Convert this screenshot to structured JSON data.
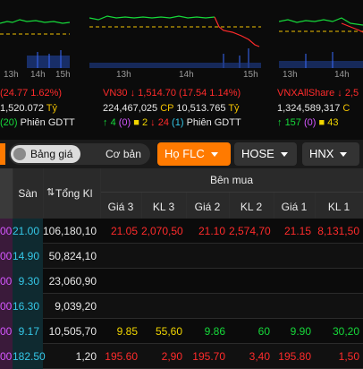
{
  "colors": {
    "up": "#16d93a",
    "down": "#ff2b2b",
    "ref": "#f2c200",
    "ceiling": "#d457ff",
    "floor": "#35c8e8",
    "accent": "#ff7a00"
  },
  "panels": [
    {
      "name": "vnindex",
      "ticks": [
        "13h",
        "14h",
        "15h"
      ]
    },
    {
      "name": "vn30",
      "ticks": [
        "13h",
        "14h",
        "15h"
      ]
    },
    {
      "name": "vnxallshare",
      "ticks": [
        "13h",
        "14h"
      ]
    }
  ],
  "indices": [
    {
      "name": "",
      "change": "(24.77 1.62%)",
      "volume": "1,520.072",
      "unit": "Tỷ",
      "sessions_count": "(20)",
      "sessions_label": "Phiên GDTT"
    },
    {
      "name": "VN30",
      "arrow": "↓",
      "value": "1,514.70",
      "change": "(17.54 1.14%)",
      "volume": "224,467,025",
      "cp": "CP",
      "value_traded": "10,513.765",
      "unit": "Tỷ",
      "up": "4",
      "ceiling": "(0)",
      "ref": "2",
      "down": "24",
      "floor": "(1)",
      "sessions_label": "Phiên GDTT"
    },
    {
      "name": "VNXAllShare",
      "arrow": "↓",
      "value": "2,5",
      "volume": "1,324,589,317",
      "volume2": "C",
      "up": "157",
      "ceiling": "(0)",
      "ref": "43"
    }
  ],
  "toolbar": {
    "toggle_label": "Bảng giá",
    "basic_label": "Cơ bản",
    "group_label": "Họ FLC",
    "exchange1": "HOSE",
    "exchange2": "HNX"
  },
  "table": {
    "col_san": "Sàn",
    "col_tong_kl": "Tổng Kl",
    "group_ben_mua": "Bên mua",
    "cols": [
      "Giá 3",
      "KL 3",
      "Giá 2",
      "KL 2",
      "Giá 1",
      "KL 1"
    ],
    "rows": [
      {
        "tran": "00",
        "san": "21.00",
        "tong": "106,180,10",
        "g3": "21.05",
        "k3": "2,070,50",
        "g2": "21.10",
        "k2": "2,574,70",
        "g1": "21.15",
        "k1": "8,131,50",
        "color": "red"
      },
      {
        "tran": "00",
        "san": "14.90",
        "tong": "50,824,10",
        "g3": "",
        "k3": "",
        "g2": "",
        "k2": "",
        "g1": "",
        "k1": "",
        "color": "red"
      },
      {
        "tran": "00",
        "san": "9.30",
        "tong": "23,060,90",
        "g3": "",
        "k3": "",
        "g2": "",
        "k2": "",
        "g1": "",
        "k1": "",
        "color": "red"
      },
      {
        "tran": "00",
        "san": "16.30",
        "tong": "9,039,20",
        "g3": "",
        "k3": "",
        "g2": "",
        "k2": "",
        "g1": "",
        "k1": "",
        "color": "red"
      },
      {
        "tran": "00",
        "san": "9.17",
        "tong": "10,505,70",
        "g3": "9.85",
        "k3": "55,60",
        "g2": "9.86",
        "k2": "60",
        "g1": "9.90",
        "k1": "30,20",
        "color": "mixed"
      },
      {
        "tran": "00",
        "san": "182.50",
        "tong": "1,20",
        "g3": "195.60",
        "k3": "2,90",
        "g2": "195.70",
        "k2": "3,40",
        "g1": "195.80",
        "k1": "1,50",
        "color": "red"
      }
    ]
  }
}
